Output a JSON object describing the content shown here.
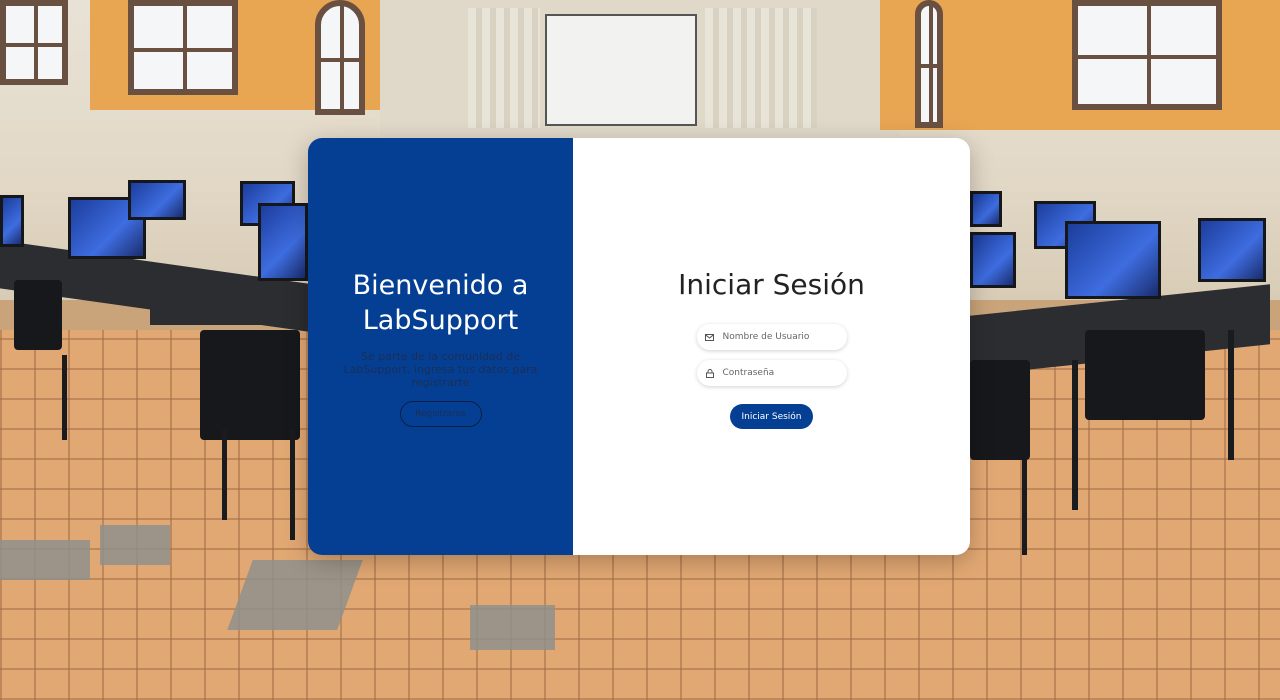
{
  "welcome": {
    "title": "Bienvenido a LabSupport",
    "subtitle": "Se parte de la comunidad de LabSupport, ingresa tus datos para registrarte",
    "register_label": "Registrarse"
  },
  "login": {
    "title": "Iniciar Sesión",
    "username_placeholder": "Nombre de Usuario",
    "password_placeholder": "Contraseña",
    "submit_label": "Iniciar Sesión"
  },
  "icons": {
    "username": "mail-icon",
    "password": "lock-icon"
  },
  "colors": {
    "brand_blue": "#053f94",
    "card_background": "#ffffff"
  }
}
